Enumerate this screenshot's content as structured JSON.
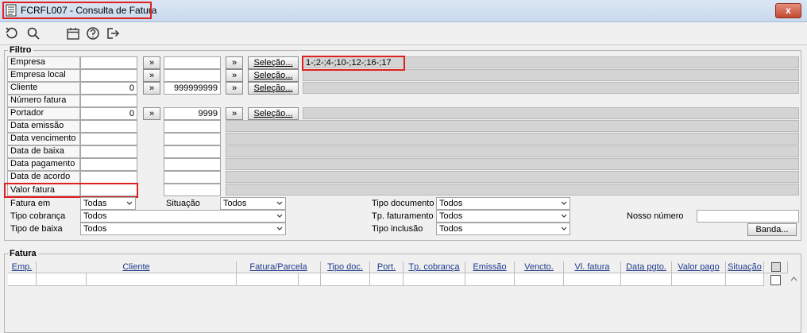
{
  "window": {
    "title": "FCRFL007 - Consulta de Fatura",
    "close_label": "x"
  },
  "toolbar": {
    "icons": [
      "undo-icon",
      "search-icon",
      "calendar-icon",
      "help-icon",
      "exit-icon"
    ]
  },
  "filtro": {
    "title": "Filtro",
    "labels": {
      "empresa": "Empresa",
      "empresa_local": "Empresa local",
      "cliente": "Cliente",
      "numero_fatura": "Número fatura",
      "portador": "Portador",
      "data_emissao": "Data emissão",
      "data_vencimento": "Data vencimento",
      "data_baixa": "Data de baixa",
      "data_pagamento": "Data pagamento",
      "data_acordo": "Data de acordo",
      "valor_fatura": "Valor fatura"
    },
    "arrow_label": "»",
    "selecao_label": "Seleção...",
    "cliente_from": "0",
    "cliente_to": "999999999",
    "portador_from": "0",
    "portador_to": "9999",
    "empresa_selection": "1-;2-;4-;10-;12-;16-;17",
    "fatura_em_label": "Fatura em",
    "fatura_em_value": "Todas",
    "situacao_label": "Situação",
    "situacao_value": "Todos",
    "tipo_cobranca_label": "Tipo cobrança",
    "tipo_cobranca_value": "Todos",
    "tipo_baixa_label": "Tipo de baixa",
    "tipo_baixa_value": "Todos",
    "tipo_documento_label": "Tipo documento",
    "tipo_documento_value": "Todos",
    "tp_faturamento_label": "Tp. faturamento",
    "tp_faturamento_value": "Todos",
    "tipo_inclusao_label": "Tipo inclusão",
    "tipo_inclusao_value": "Todos",
    "nosso_numero_label": "Nosso número",
    "banda_label": "Banda..."
  },
  "fatura": {
    "title": "Fatura",
    "columns": [
      "Emp.",
      "Cliente",
      "Fatura/Parcela",
      "Tipo doc.",
      "Port.",
      "Tp. cobrança",
      "Emissão",
      "Vencto.",
      "Vl. fatura",
      "Data pgto.",
      "Valor pago",
      "Situação"
    ]
  }
}
